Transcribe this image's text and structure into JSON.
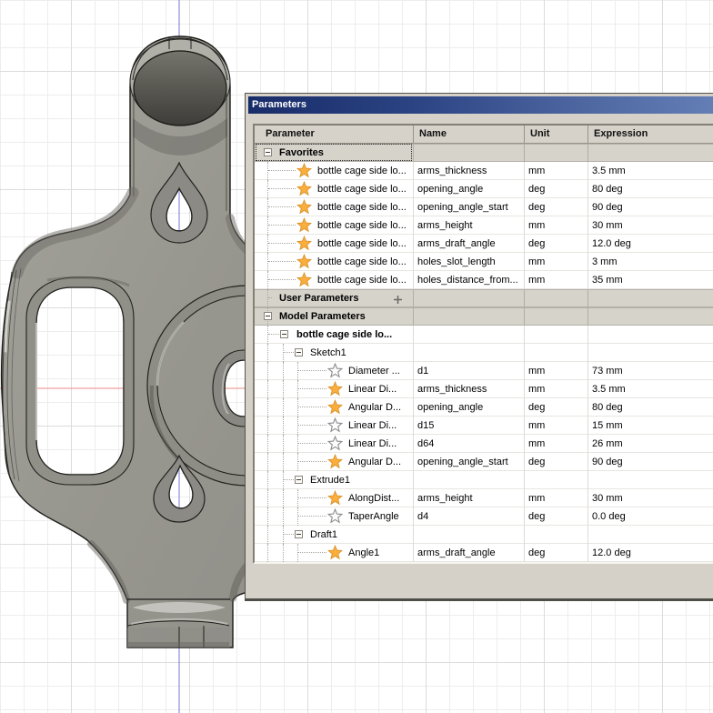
{
  "window": {
    "title": "Parameters"
  },
  "table": {
    "headers": [
      "Parameter",
      "Name",
      "Unit",
      "Expression"
    ],
    "rows": [
      {
        "kind": "group",
        "level": 0,
        "label": "Favorites",
        "bold": true,
        "gray": true,
        "expand": true,
        "focus": true
      },
      {
        "kind": "param",
        "level": 1,
        "star": "filled",
        "param": "bottle cage side lo...",
        "name": "arms_thickness",
        "unit": "mm",
        "expr": "3.5 mm"
      },
      {
        "kind": "param",
        "level": 1,
        "star": "filled",
        "param": "bottle cage side lo...",
        "name": "opening_angle",
        "unit": "deg",
        "expr": "80 deg"
      },
      {
        "kind": "param",
        "level": 1,
        "star": "filled",
        "param": "bottle cage side lo...",
        "name": "opening_angle_start",
        "unit": "deg",
        "expr": "90 deg"
      },
      {
        "kind": "param",
        "level": 1,
        "star": "filled",
        "param": "bottle cage side lo...",
        "name": "arms_height",
        "unit": "mm",
        "expr": "30 mm"
      },
      {
        "kind": "param",
        "level": 1,
        "star": "filled",
        "param": "bottle cage side lo...",
        "name": "arms_draft_angle",
        "unit": "deg",
        "expr": "12.0 deg"
      },
      {
        "kind": "param",
        "level": 1,
        "star": "filled",
        "param": "bottle cage side lo...",
        "name": "holes_slot_length",
        "unit": "mm",
        "expr": "3 mm"
      },
      {
        "kind": "param",
        "level": 1,
        "star": "filled",
        "param": "bottle cage side lo...",
        "name": "holes_distance_from...",
        "unit": "mm",
        "expr": "35 mm"
      },
      {
        "kind": "group",
        "level": 0,
        "label": "User Parameters",
        "bold": true,
        "gray": true,
        "plus": true
      },
      {
        "kind": "group",
        "level": 0,
        "label": "Model Parameters",
        "bold": true,
        "gray": true,
        "expand": true
      },
      {
        "kind": "group",
        "level": 1,
        "label": "bottle cage side lo...",
        "bold": true,
        "expand": true
      },
      {
        "kind": "group",
        "level": 2,
        "label": "Sketch1",
        "expand": true
      },
      {
        "kind": "param",
        "level": 3,
        "star": "outline",
        "param": "Diameter ...",
        "name": "d1",
        "unit": "mm",
        "expr": "73 mm"
      },
      {
        "kind": "param",
        "level": 3,
        "star": "filled",
        "param": "Linear Di...",
        "name": "arms_thickness",
        "unit": "mm",
        "expr": "3.5 mm"
      },
      {
        "kind": "param",
        "level": 3,
        "star": "filled",
        "param": "Angular D...",
        "name": "opening_angle",
        "unit": "deg",
        "expr": "80 deg"
      },
      {
        "kind": "param",
        "level": 3,
        "star": "outline",
        "param": "Linear Di...",
        "name": "d15",
        "unit": "mm",
        "expr": "15 mm"
      },
      {
        "kind": "param",
        "level": 3,
        "star": "outline",
        "param": "Linear Di...",
        "name": "d64",
        "unit": "mm",
        "expr": "26 mm"
      },
      {
        "kind": "param",
        "level": 3,
        "star": "filled",
        "param": "Angular D...",
        "name": "opening_angle_start",
        "unit": "deg",
        "expr": "90 deg"
      },
      {
        "kind": "group",
        "level": 2,
        "label": "Extrude1",
        "expand": true
      },
      {
        "kind": "param",
        "level": 3,
        "star": "filled",
        "param": "AlongDist...",
        "name": "arms_height",
        "unit": "mm",
        "expr": "30 mm"
      },
      {
        "kind": "param",
        "level": 3,
        "star": "outline",
        "param": "TaperAngle",
        "name": "d4",
        "unit": "deg",
        "expr": "0.0 deg"
      },
      {
        "kind": "group",
        "level": 2,
        "label": "Draft1",
        "expand": true
      },
      {
        "kind": "param",
        "level": 3,
        "star": "filled",
        "param": "Angle1",
        "name": "arms_draft_angle",
        "unit": "deg",
        "expr": "12.0 deg"
      }
    ]
  },
  "colors": {
    "title_gradient_start": "#182c69",
    "title_gradient_end": "#6682b8",
    "star_filled": "#FBAE3C",
    "dialog_bg": "#d5d1c9",
    "section_row_bg": "#d6d3cb",
    "x_axis": "#f0a09e",
    "y_axis": "#8a8edd"
  }
}
